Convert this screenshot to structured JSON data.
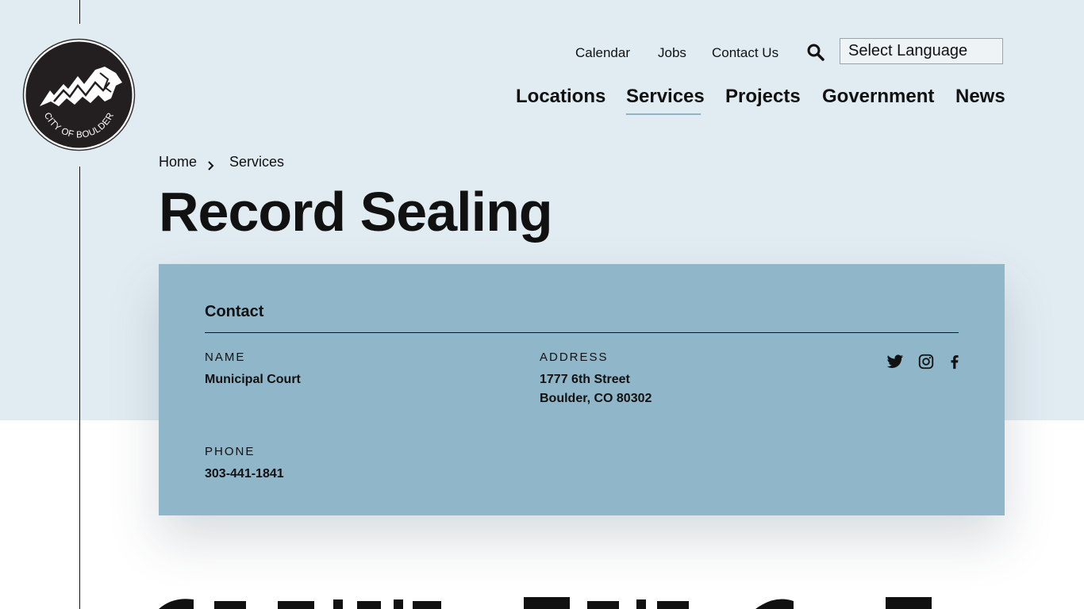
{
  "brand": {
    "logo_alt": "City of Boulder",
    "logo_text": "CITY OF BOULDER"
  },
  "utility_nav": {
    "items": [
      "Calendar",
      "Jobs",
      "Contact Us"
    ],
    "search_icon": "search-icon",
    "language_select": "Select Language"
  },
  "main_nav": {
    "items": [
      "Locations",
      "Services",
      "Projects",
      "Government",
      "News"
    ],
    "active": "Services"
  },
  "breadcrumb": {
    "items": [
      "Home",
      "Services"
    ],
    "separator_icon": "chevron-right-icon"
  },
  "page": {
    "title": "Record Sealing"
  },
  "contact": {
    "heading": "Contact",
    "name_label": "NAME",
    "name_value": "Municipal Court",
    "address_label": "ADDRESS",
    "address_line1": "1777 6th Street",
    "address_line2": "Boulder, CO 80302",
    "phone_label": "PHONE",
    "phone_value": "303-441-1841",
    "social_icons": [
      "twitter-icon",
      "instagram-icon",
      "facebook-icon"
    ]
  },
  "colors": {
    "top_band": "#e1ecf2",
    "card": "#8fb6c9",
    "active_underline": "#8fb5c8",
    "text": "#111111"
  }
}
